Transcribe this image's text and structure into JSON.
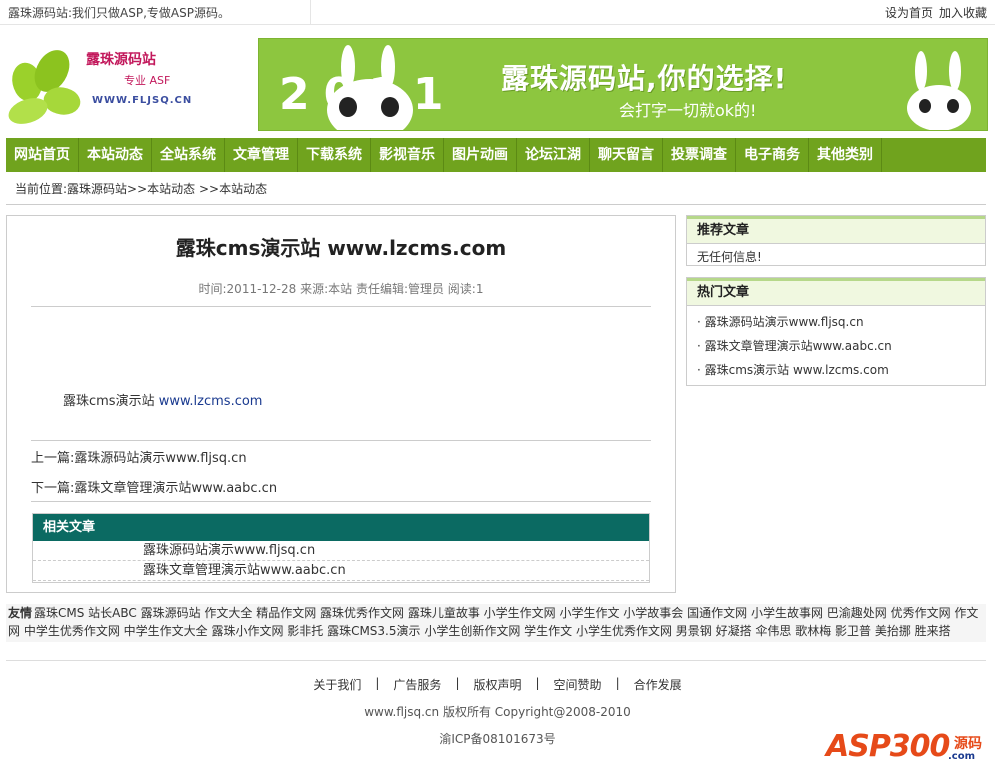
{
  "topbar": {
    "slogan": "露珠源码站:我们只做ASP,专做ASP源码。",
    "set_home": "设为首页",
    "add_fav": "加入收藏"
  },
  "logo": {
    "name": "露珠源码站",
    "tagline": "专业 ASF",
    "domain": "WWW.FLJSQ.CN"
  },
  "banner": {
    "headline": "露珠源码站,你的选择!",
    "sub": "会打字一切就ok的!",
    "digits": "2011"
  },
  "nav": [
    "网站首页",
    "本站动态",
    "全站系统",
    "文章管理",
    "下载系统",
    "影视音乐",
    "图片动画",
    "论坛江湖",
    "聊天留言",
    "投票调查",
    "电子商务",
    "其他类别"
  ],
  "breadcrumb": "当前位置:露珠源码站>>本站动态 >>本站动态",
  "article": {
    "title": "露珠cms演示站 www.lzcms.com",
    "meta": "时间:2011-12-28  来源:本站  责任编辑:管理员  阅读:1",
    "body_prefix": "露珠cms演示站 ",
    "body_link": "www.lzcms.com",
    "prev": "上一篇:露珠源码站演示www.fljsq.cn",
    "next": "下一篇:露珠文章管理演示站www.aabc.cn"
  },
  "related": {
    "title": "相关文章",
    "items": [
      "露珠源码站演示www.fljsq.cn",
      "露珠文章管理演示站www.aabc.cn"
    ]
  },
  "sidebar": {
    "recommended_title": "推荐文章",
    "recommended_empty": "无任何信息!",
    "hot_title": "热门文章",
    "hot_items": [
      "· 露珠源码站演示www.fljsq.cn",
      "· 露珠文章管理演示站www.aabc.cn",
      "· 露珠cms演示站 www.lzcms.com"
    ]
  },
  "friend_links": {
    "label": "友情",
    "text": "露珠CMS 站长ABC 露珠源码站 作文大全 精品作文网 露珠优秀作文网 露珠儿童故事 小学生作文网 小学生作文 小学故事会 国通作文网 小学生故事网 巴渝趣处网 优秀作文网 作文网 中学生优秀作文网 中学生作文大全 露珠小作文网 影非托 露珠CMS3.5演示 小学生创新作文网 学生作文 小学生优秀作文网 男景钢 好凝搭 伞伟思 歌林梅 影卫普 美抬挪 胜来搭"
  },
  "footer": {
    "links": [
      "关于我们",
      "广告服务",
      "版权声明",
      "空间赞助",
      "合作发展"
    ],
    "separator": "|",
    "copyright": "www.fljsq.cn 版权所有 Copyright@2008-2010",
    "icp": "渝ICP备08101673号"
  },
  "watermark": {
    "brand": "ASP300",
    "tag": "源码",
    "com": ".com"
  },
  "colors": {
    "nav_bg": "#70a31e",
    "related_header": "#0b6a62",
    "banner_bg": "#8dc63f"
  }
}
